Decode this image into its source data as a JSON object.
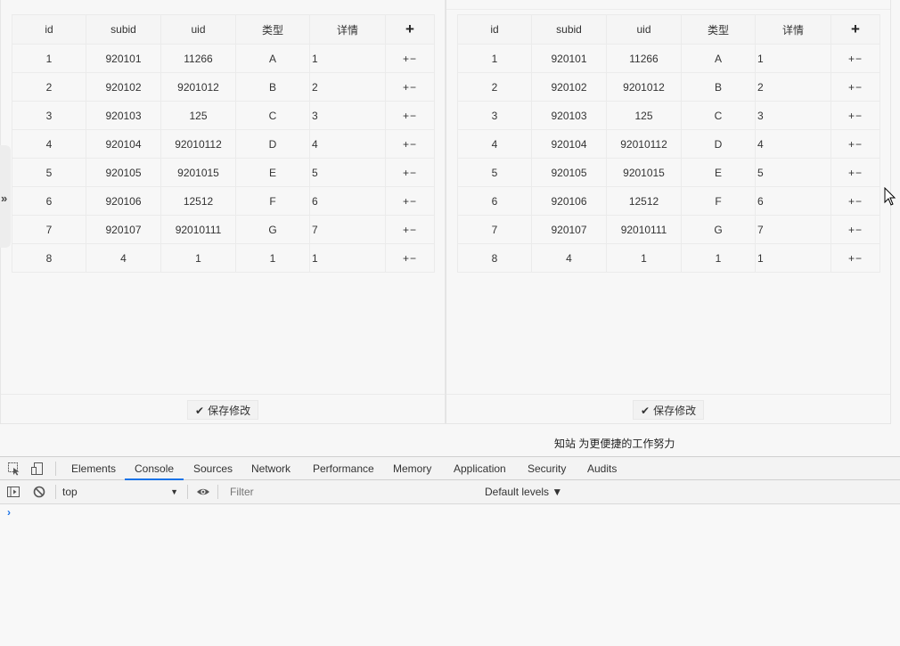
{
  "table": {
    "headers": [
      "id",
      "subid",
      "uid",
      "类型",
      "详情"
    ],
    "add_column_label": "+",
    "rows": [
      [
        "1",
        "920101",
        "11266",
        "A",
        "1"
      ],
      [
        "2",
        "920102",
        "9201012",
        "B",
        "2"
      ],
      [
        "3",
        "920103",
        "125",
        "C",
        "3"
      ],
      [
        "4",
        "920104",
        "92010112",
        "D",
        "4"
      ],
      [
        "5",
        "920105",
        "9201015",
        "E",
        "5"
      ],
      [
        "6",
        "920106",
        "12512",
        "F",
        "6"
      ],
      [
        "7",
        "920107",
        "92010111",
        "G",
        "7"
      ],
      [
        "8",
        "4",
        "1",
        "1",
        "1"
      ]
    ],
    "row_add_label": "+",
    "row_remove_label": "−"
  },
  "save_button_label": "保存修改",
  "save_check_glyph": "✔",
  "sidebar_toggle_glyph": "»",
  "slogan": "知站 为更便捷的工作努力",
  "devtools": {
    "tabs": [
      "Elements",
      "Console",
      "Sources",
      "Network",
      "Performance",
      "Memory",
      "Application",
      "Security",
      "Audits"
    ],
    "active_tab": "Console",
    "context": "top",
    "filter_placeholder": "Filter",
    "levels_label": "Default levels ▼",
    "prompt_glyph": "›",
    "accent_color": "#1a73e8"
  }
}
